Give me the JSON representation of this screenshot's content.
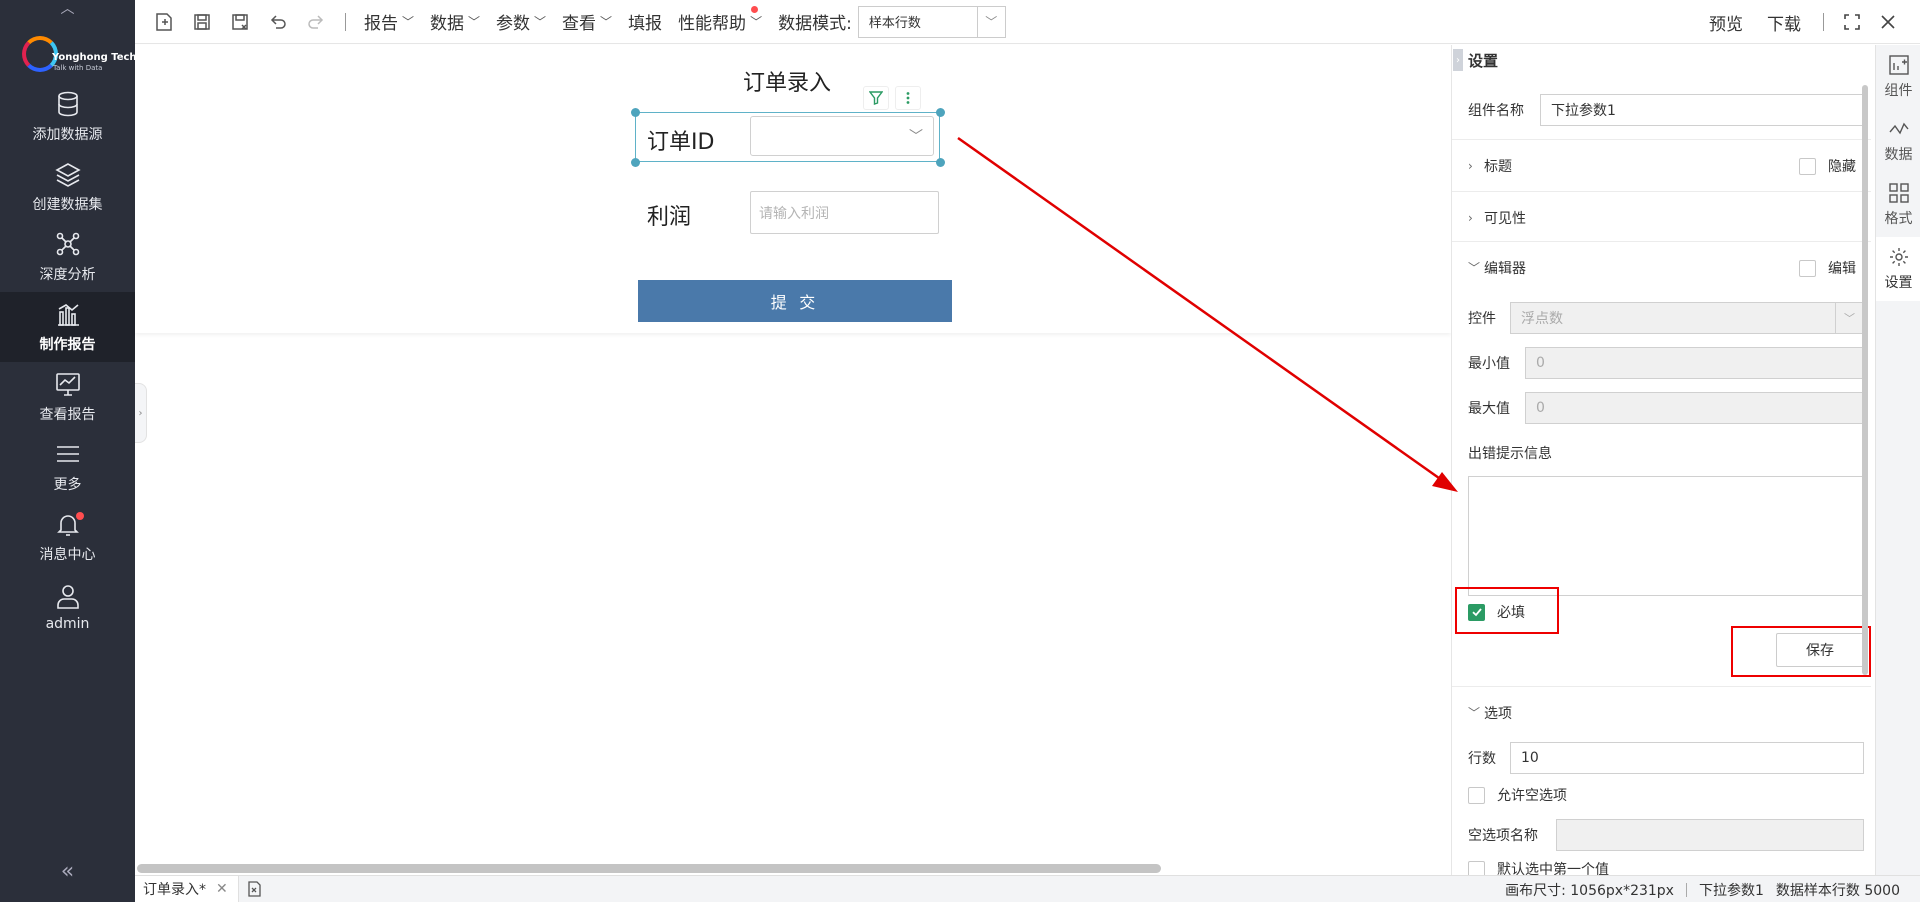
{
  "logo": {
    "name": "Yonghong Tech",
    "tagline": "Talk with Data"
  },
  "nav": {
    "items": [
      {
        "label": "添加数据源",
        "icon": "database-icon"
      },
      {
        "label": "创建数据集",
        "icon": "layers-icon"
      },
      {
        "label": "深度分析",
        "icon": "network-icon"
      },
      {
        "label": "制作报告",
        "icon": "bar-chart-icon",
        "active": true
      },
      {
        "label": "查看报告",
        "icon": "monitor-chart-icon"
      },
      {
        "label": "更多",
        "icon": "menu-icon"
      },
      {
        "label": "消息中心",
        "icon": "bell-icon",
        "badge": true
      },
      {
        "label": "admin",
        "icon": "user-icon"
      }
    ]
  },
  "toolbar": {
    "menus": [
      "报告",
      "数据",
      "参数",
      "查看",
      "填报",
      "性能帮助"
    ],
    "data_mode_label": "数据模式:",
    "data_mode_value": "样本行数",
    "preview": "预览",
    "download": "下载"
  },
  "form": {
    "title": "订单录入",
    "order_label": "订单ID",
    "profit_label": "利润",
    "profit_placeholder": "请输入利润",
    "submit": "提 交"
  },
  "props": {
    "header": "设置",
    "component_name_label": "组件名称",
    "component_name_value": "下拉参数1",
    "title_section": "标题",
    "hide_label": "隐藏",
    "visibility_section": "可见性",
    "editor_section": "编辑器",
    "edit_label": "编辑",
    "control_label": "控件",
    "control_value": "浮点数",
    "min_label": "最小值",
    "min_value": "0",
    "max_label": "最大值",
    "max_value": "0",
    "error_label": "出错提示信息",
    "required_label": "必填",
    "required_checked": true,
    "save": "保存",
    "options_section": "选项",
    "rows_label": "行数",
    "rows_value": "10",
    "allow_empty_label": "允许空选项",
    "empty_name_label": "空选项名称",
    "default_first_label": "默认选中第一个值"
  },
  "rtabs": [
    {
      "label": "组件",
      "icon": "component-icon"
    },
    {
      "label": "数据",
      "icon": "data-icon"
    },
    {
      "label": "格式",
      "icon": "grid-icon"
    },
    {
      "label": "设置",
      "icon": "gear-icon",
      "active": true
    }
  ],
  "status": {
    "tab_name": "订单录入*",
    "canvas_size": "画布尺寸: 1056px*231px",
    "selected": "下拉参数1",
    "sample_rows": "数据样本行数 5000"
  },
  "colors": {
    "accent": "#2b9b64",
    "submit": "#4a79aa",
    "highlight": "#e00000",
    "sidebar": "#2b2f3a"
  }
}
